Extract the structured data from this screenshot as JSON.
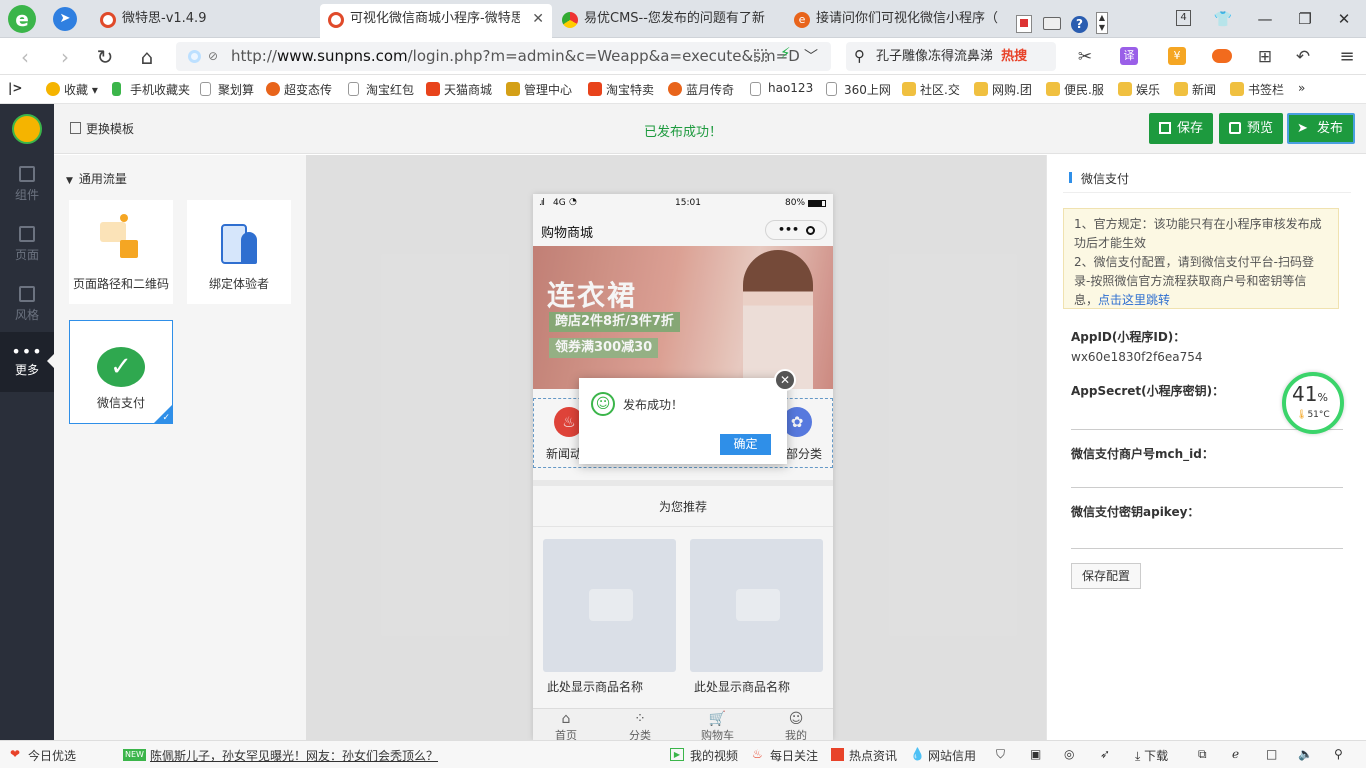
{
  "browser": {
    "tabs": [
      {
        "title": "微特思-v1.4.9",
        "active": false
      },
      {
        "title": "可视化微信商城小程序-微特思-v",
        "active": true
      },
      {
        "title": "易优CMS--您发布的问题有了新",
        "active": false
      },
      {
        "title": "接请问你们可视化微信小程序（",
        "active": false
      }
    ],
    "tab_count": "4",
    "url_prefix": "http://",
    "url_host": "www.sunpns.com",
    "url_rest": "/login.php?m=admin&c=Weapp&a=execute&sm=D",
    "search_text": "孔子雕像冻得流鼻涕",
    "search_badge": "热搜",
    "translate_label": "译"
  },
  "bookmarks": [
    {
      "label": "收藏",
      "color": "#f5b400"
    },
    {
      "label": "手机收藏夹",
      "color": "#3bb54a"
    },
    {
      "label": "聚划算",
      "color": "#999999"
    },
    {
      "label": "超变态传",
      "color": "#e8641b"
    },
    {
      "label": "淘宝红包",
      "color": "#999999"
    },
    {
      "label": "天猫商城",
      "color": "#e8431b"
    },
    {
      "label": "管理中心",
      "color": "#d4a017"
    },
    {
      "label": "淘宝特卖",
      "color": "#e8431b"
    },
    {
      "label": "蓝月传奇",
      "color": "#e8641b"
    },
    {
      "label": "hao123",
      "color": "#999999"
    },
    {
      "label": "360上网",
      "color": "#999999"
    },
    {
      "label": "社区.交",
      "color": "#f0c040"
    },
    {
      "label": "网购.团",
      "color": "#f0c040"
    },
    {
      "label": "便民.服",
      "color": "#f0c040"
    },
    {
      "label": "娱乐",
      "color": "#f0c040"
    },
    {
      "label": "新闻",
      "color": "#f0c040"
    },
    {
      "label": "书签栏",
      "color": "#f0c040"
    }
  ],
  "leftnav": [
    {
      "label": "组件",
      "active": false
    },
    {
      "label": "页面",
      "active": false
    },
    {
      "label": "风格",
      "active": false
    },
    {
      "label": "更多",
      "active": true
    }
  ],
  "topbar": {
    "template_label": "更换模板",
    "status_message": "已发布成功！",
    "save_label": "保存",
    "preview_label": "预览",
    "publish_label": "发布"
  },
  "components": {
    "group_title": "通用流量",
    "items": [
      {
        "label": "页面路径和二维码"
      },
      {
        "label": "绑定体验者"
      },
      {
        "label": "微信支付"
      }
    ]
  },
  "phone": {
    "signal": "4G",
    "time": "15:01",
    "battery": "80%",
    "title": "购物商城",
    "banner_title": "连衣裙",
    "banner_line1": "跨店2件8折/3件7折",
    "banner_line2": "领券满300减30",
    "nav_left": "新闻动",
    "nav_right": "部分类",
    "recommend_title": "为您推荐",
    "product_name": "此处显示商品名称",
    "tabbar": [
      "首页",
      "分类",
      "购物车",
      "我的"
    ]
  },
  "dialog": {
    "message": "发布成功！",
    "confirm_label": "确定"
  },
  "panel": {
    "title": "微信支付",
    "notice_line1": "1、官方规定：该功能只有在小程序审核发布成功后才能生效",
    "notice_line2_text": "2、微信支付配置，请到微信支付平台-扫码登录-按照微信官方流程获取商户号和密钥等信息，",
    "notice_link": "点击这里跳转",
    "appid_label": "AppID(小程序ID)：",
    "appid_value": "wx60e1830f2f6ea754",
    "secret_label": "AppSecret(小程序密钥)：",
    "mchid_label": "微信支付商户号mch_id：",
    "apikey_label": "微信支付密钥apikey：",
    "save_config_label": "保存配置"
  },
  "gauge": {
    "percent": "41",
    "unit": "%",
    "temp": "51°C"
  },
  "statusbar": {
    "today": "今日优选",
    "new_badge": "NEW",
    "headline": "陈佩斯儿子，孙女罕见曝光！网友：孙女们会秃顶么？",
    "items": [
      "我的视频",
      "每日关注",
      "热点资讯",
      "网站信用"
    ],
    "download": "下载"
  },
  "colors": {
    "green": "#1d9a3e",
    "blue": "#2f8fe8",
    "wechat": "#2fa84f",
    "nav_bg": "#2a2f3a"
  }
}
